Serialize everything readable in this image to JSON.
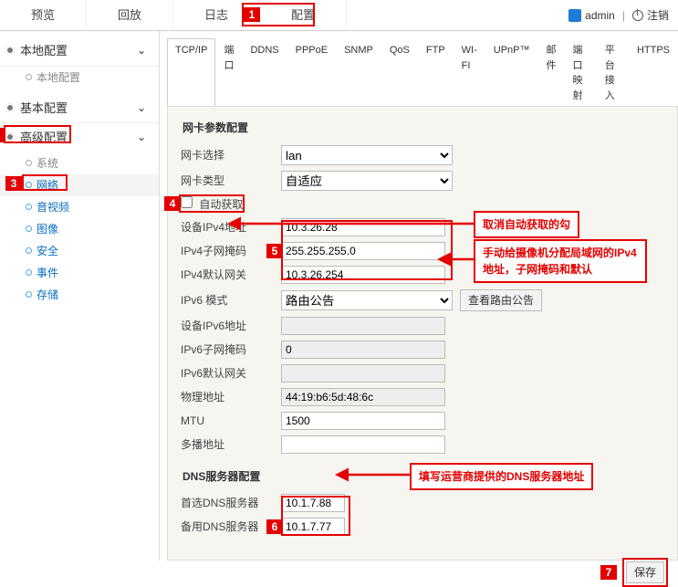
{
  "topnav": {
    "preview": "预览",
    "playback": "回放",
    "log": "日志",
    "config": "配置"
  },
  "user": {
    "name": "admin",
    "logout": "注销"
  },
  "sidebar": {
    "g0": {
      "title": "本地配置",
      "items": [
        "本地配置"
      ]
    },
    "g1": {
      "title": "基本配置"
    },
    "g2": {
      "title": "高级配置",
      "items": [
        "系统",
        "网络",
        "音视频",
        "图像",
        "安全",
        "事件",
        "存储"
      ]
    }
  },
  "subtabs": [
    "TCP/IP",
    "端口",
    "DDNS",
    "PPPoE",
    "SNMP",
    "QoS",
    "FTP",
    "WI-FI",
    "UPnP™",
    "邮件",
    "端口映射",
    "平台接入",
    "HTTPS"
  ],
  "section1": "网卡参数配置",
  "rows": {
    "nic_select": "网卡选择",
    "nic_type": "网卡类型",
    "auto_get": "自动获取",
    "ipv4_addr": "设备IPv4地址",
    "ipv4_mask": "IPv4子网掩码",
    "ipv4_gw": "IPv4默认网关",
    "ipv6_mode": "IPv6 模式",
    "ipv6_addr": "设备IPv6地址",
    "ipv6_prefix": "IPv6子网掩码",
    "ipv6_gw": "IPv6默认网关",
    "mac": "物理地址",
    "mtu": "MTU",
    "multicast": "多播地址"
  },
  "vals": {
    "nic_select": "lan",
    "nic_type": "自适应",
    "ipv4_addr": "10.3.26.28",
    "ipv4_mask": "255.255.255.0",
    "ipv4_gw": "10.3.26.254",
    "ipv6_mode": "路由公告",
    "ipv6_btn": "查看路由公告",
    "ipv6_addr": "",
    "ipv6_prefix": "0",
    "ipv6_gw": "",
    "mac": "44:19:b6:5d:48:6c",
    "mtu": "1500",
    "multicast": ""
  },
  "section2": "DNS服务器配置",
  "dns": {
    "primary_lbl": "首选DNS服务器",
    "primary": "10.1.7.88",
    "alt_lbl": "备用DNS服务器",
    "alt": "10.1.7.77"
  },
  "save": "保存",
  "callouts": {
    "c4": "取消自动获取的勾",
    "c5": "手动给摄像机分配局域网的IPv4地址，子网掩码和默认",
    "c6": "填写运营商提供的DNS服务器地址"
  }
}
